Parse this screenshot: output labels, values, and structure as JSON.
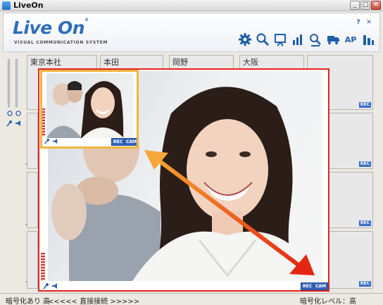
{
  "window": {
    "title": "LiveOn",
    "minimize_glyph": "_",
    "maximize_glyph": "□",
    "close_glyph": "✕"
  },
  "header": {
    "logo_text": "Live On",
    "logo_tm": "®",
    "tagline": "VISUAL COMMUNICATION SYSTEM",
    "help_label": "?",
    "close_label": "✕",
    "ap_label": "AP",
    "toolbar_icons": [
      "gear-icon",
      "search-icon",
      "whiteboard-icon",
      "bar-chart-icon",
      "person-search-icon",
      "transfer-icon",
      "ap-button",
      "level-icon"
    ]
  },
  "tiles": {
    "names": [
      "東京本社",
      "本田",
      "岡野",
      "大阪"
    ],
    "rec_label": "REC"
  },
  "main_video": {
    "rec_label": "REC",
    "cam_label": "CAM"
  },
  "pip_video": {
    "rec_label": "REC",
    "cam_label": "CAM"
  },
  "status": {
    "left": "暗号化あり 高",
    "middle": "<<<<< 直接接続 >>>>>",
    "right": "暗号化レベル：高"
  },
  "colors": {
    "accent": "#2e6fb8",
    "main_border": "#e3241f",
    "pip_border": "#f0b43c",
    "arrow": "#f07a1e"
  }
}
